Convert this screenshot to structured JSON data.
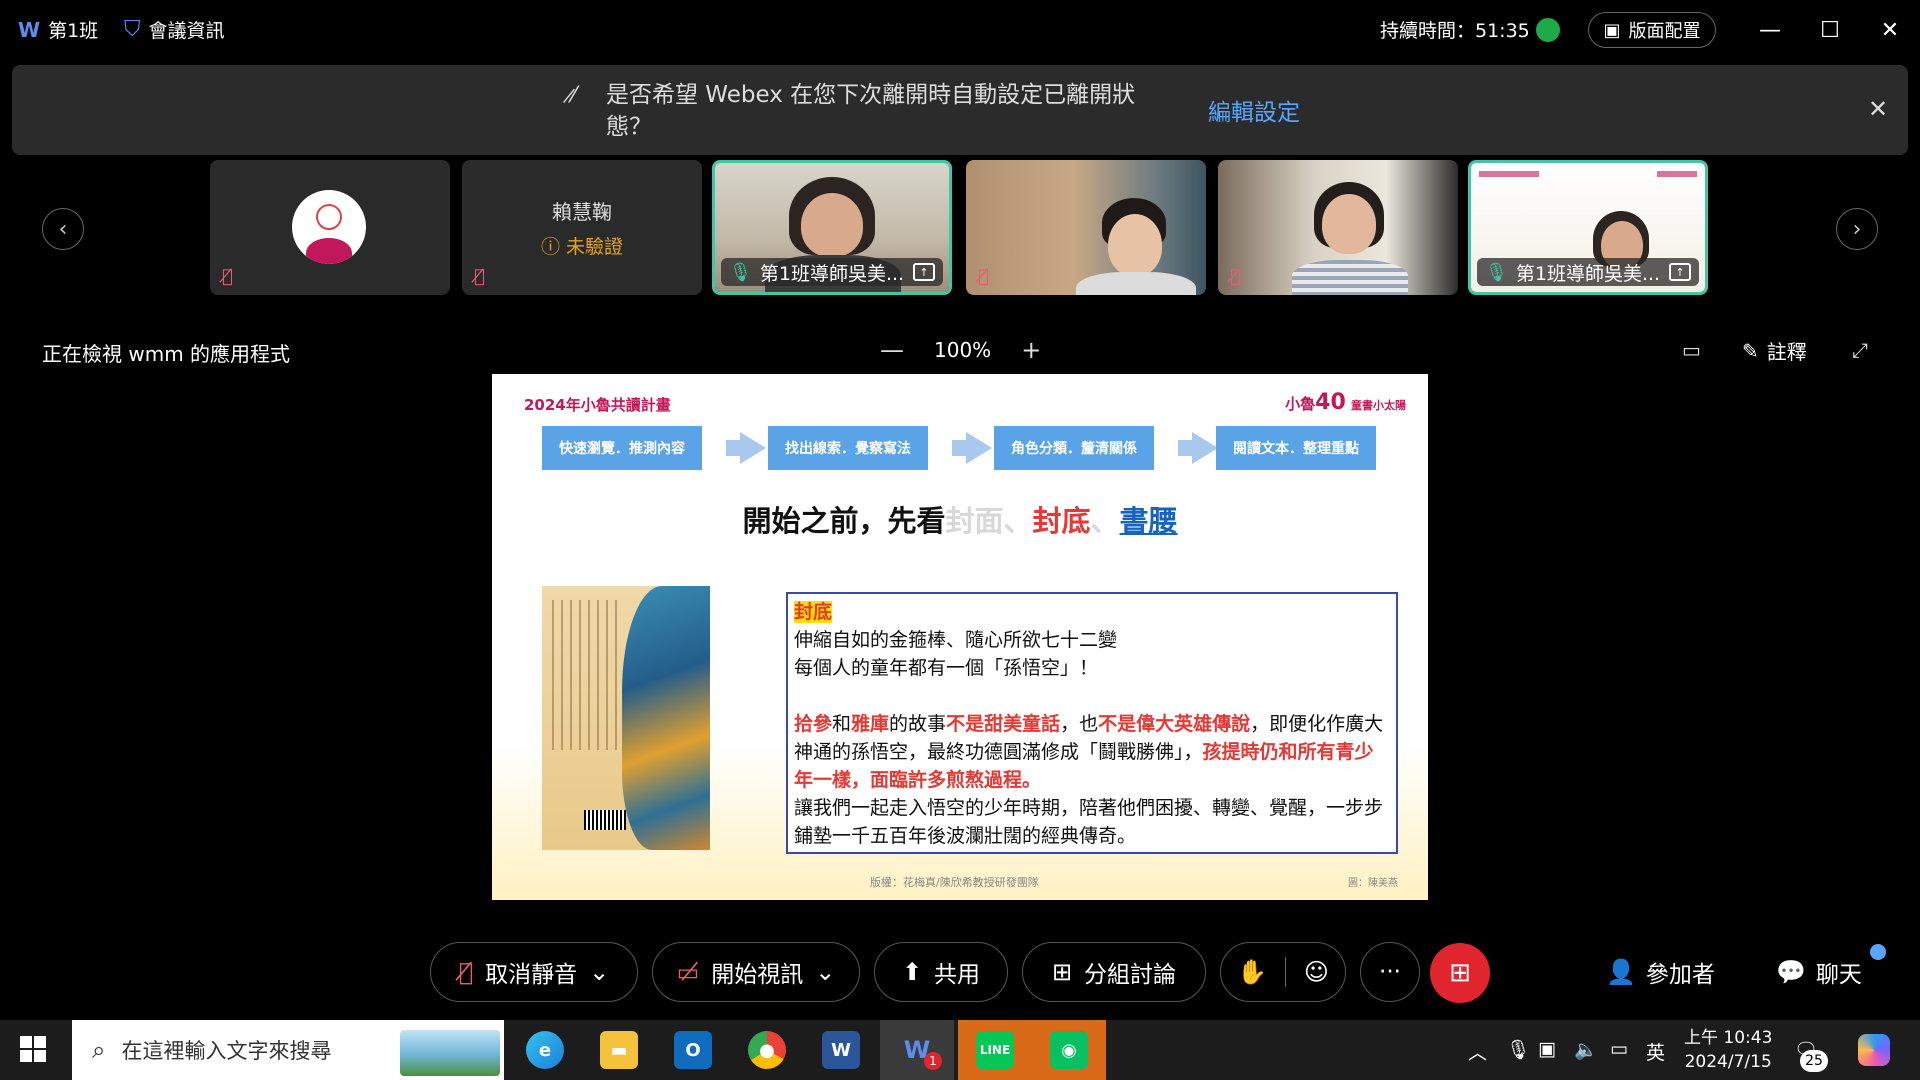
{
  "window": {
    "meeting_name": "第1班",
    "meeting_info": "會議資訊",
    "duration": "持續時間：51:35",
    "layout_label": "版面配置",
    "minimize": "—",
    "maximize": "☐",
    "close": "✕"
  },
  "banner": {
    "message": "是否希望 Webex 在您下次離開時自動設定已離開狀態？",
    "edit_link": "編輯設定",
    "close": "✕"
  },
  "participants": [
    {
      "name": "",
      "muted": true
    },
    {
      "name": "賴慧鞠",
      "status": "未驗證",
      "muted": true
    },
    {
      "name": "第1班導師吳美...",
      "active": true
    },
    {
      "name": "",
      "muted": true
    },
    {
      "name": "",
      "muted": true
    },
    {
      "name": "第1班導師吳美...",
      "active": true
    }
  ],
  "share_header": {
    "viewing": "正在檢視 wmm 的應用程式",
    "zoom_minus": "—",
    "zoom_level": "100%",
    "zoom_plus": "+",
    "annotate": "註釋"
  },
  "slide": {
    "plan_title": "2024年小魯共讀計畫",
    "brand_prefix": "小魯",
    "brand_num": "40",
    "brand_suffix": "童書小太陽",
    "steps": [
      "快速瀏覽．推測內容",
      "找出線索．覺察寫法",
      "角色分類．釐清關係",
      "閱讀文本．整理重點"
    ],
    "headline_a": "開始之前，先看",
    "headline_b": "封面",
    "headline_sep1": "、",
    "headline_c": "封底",
    "headline_sep2": "、",
    "headline_d": "書腰",
    "box_title": "封底",
    "line1": "伸縮自如的金箍棒、隨心所欲七十二變",
    "line2": "每個人的童年都有一個「孫悟空」！",
    "p3_a": "拾參",
    "p3_b": "和",
    "p3_c": "雅庫",
    "p3_d": "的故事",
    "p3_e": "不是甜美童話",
    "p3_f": "，也",
    "p3_g": "不是偉大英雄傳說",
    "p3_h": "，即便化作廣大神通的孫悟空，最終功德圓滿修成「鬪戰勝佛」，",
    "p3_i": "孩提時仍和所有青少年一樣，面臨許多煎熬過程。",
    "line4": "讓我們一起走入悟空的少年時期，陪著他們困擾、轉變、覺醒，一步步鋪墊一千五百年後波瀾壯闊的經典傳奇。",
    "credit": "版權：花梅真/陳欣希教授研發團隊",
    "credit2": "圖：陳美燕"
  },
  "controls": {
    "unmute": "取消靜音",
    "start_video": "開始視訊",
    "share": "共用",
    "breakout": "分組討論",
    "more": "···",
    "participants": "參加者",
    "chat": "聊天"
  },
  "taskbar": {
    "search_placeholder": "在這裡輸入文字來搜尋",
    "ime": "英",
    "time": "上午 10:43",
    "date": "2024/7/15",
    "notification_count": "25",
    "webex_badge": "1"
  },
  "colors": {
    "accent": "#3fc7a6",
    "danger": "#e0252f",
    "link": "#58a6ff"
  }
}
